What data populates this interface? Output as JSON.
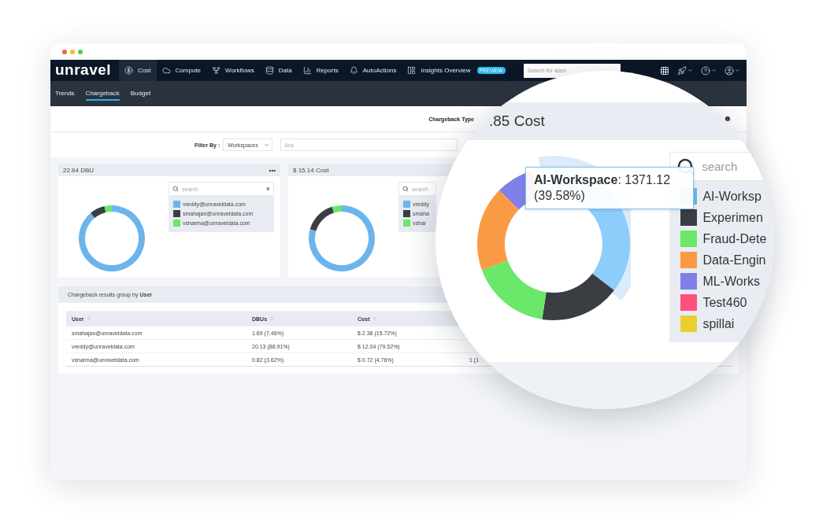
{
  "nav": {
    "logo": "unravel",
    "items": [
      {
        "label": "Cost",
        "kind": "dollar",
        "selected": true
      },
      {
        "label": "Compute",
        "kind": "cloud",
        "selected": false
      },
      {
        "label": "Workflows",
        "kind": "workflow",
        "selected": false
      },
      {
        "label": "Data",
        "kind": "database",
        "selected": false
      },
      {
        "label": "Reports",
        "kind": "reports",
        "selected": false
      },
      {
        "label": "AutoActions",
        "kind": "bell",
        "selected": false
      },
      {
        "label": "Insights Overview",
        "kind": "panel",
        "selected": false,
        "badge": "PREVIEW"
      }
    ],
    "search": {
      "placeholder": "Search for apps"
    }
  },
  "subnav": [
    {
      "label": "Trends",
      "selected": false
    },
    {
      "label": "Chargeback",
      "selected": true
    },
    {
      "label": "Budget",
      "selected": false
    }
  ],
  "chargeback_type": {
    "label": "Chargeback Type"
  },
  "filter": {
    "label": "Filter By :",
    "select": "Workspaces",
    "input_placeholder": "Any"
  },
  "cards": [
    {
      "title": "22.64 DBU",
      "menu": "•••",
      "search_placeholder": "search",
      "close": "×",
      "legend": [
        {
          "label": "vreddy@unraveldata.com",
          "color": "#6bb5ec"
        },
        {
          "label": "smahajan@unraveldata.com",
          "color": "#3a3d42"
        },
        {
          "label": "vsharma@unraveldata.com",
          "color": "#6ae86a"
        }
      ],
      "chart_data": {
        "type": "donut",
        "series": [
          {
            "values": [
              88.91,
              7.46,
              3.63
            ]
          }
        ]
      }
    },
    {
      "title": "$ 15.14 Cost",
      "search_placeholder": "search",
      "legend": [
        {
          "label": "vreddy",
          "color": "#6bb5ec"
        },
        {
          "label": "smaha",
          "color": "#3a3d42"
        },
        {
          "label": "vshar",
          "color": "#6ae86a"
        }
      ],
      "chart_data": {
        "type": "donut",
        "series": [
          {
            "values": [
              79.52,
              15.72,
              4.76
            ]
          }
        ]
      }
    }
  ],
  "table": {
    "title": "Chargeback results group by **User**",
    "columns": [
      "User",
      "DBUs",
      "Cost"
    ],
    "rows": [
      {
        "cells": [
          "smahajan@unraveldata.com",
          "1.69 (7.46%)",
          "$ 2.38 (15.72%)"
        ]
      },
      {
        "cells": [
          "vreddy@unraveldata.com",
          "20.13 (88.91%)",
          "$ 12.04 (79.52%)"
        ]
      },
      {
        "cells": [
          "vsharma@unraveldata.com",
          "0.82 (3.62%)",
          "$ 0.72 (4.76%)",
          "1 (1"
        ]
      }
    ]
  },
  "magnifier": {
    "title": ".85 Cost",
    "tooltip": "**AI-Workspace**: 1371.12 (39.58%)",
    "search_placeholder": "search",
    "legend": [
      {
        "label": "AI-Worksp",
        "color": "#6bb5ec"
      },
      {
        "label": "Experimen",
        "color": "#3a3d42"
      },
      {
        "label": "Fraud-Dete",
        "color": "#6ae86a"
      },
      {
        "label": "Data-Engin",
        "color": "#fb9a45"
      },
      {
        "label": "ML-Works",
        "color": "#7f7fe8"
      },
      {
        "label": "Test460",
        "color": "#ff4f7b"
      },
      {
        "label": "spillai",
        "color": "#e8d030"
      }
    ]
  }
}
